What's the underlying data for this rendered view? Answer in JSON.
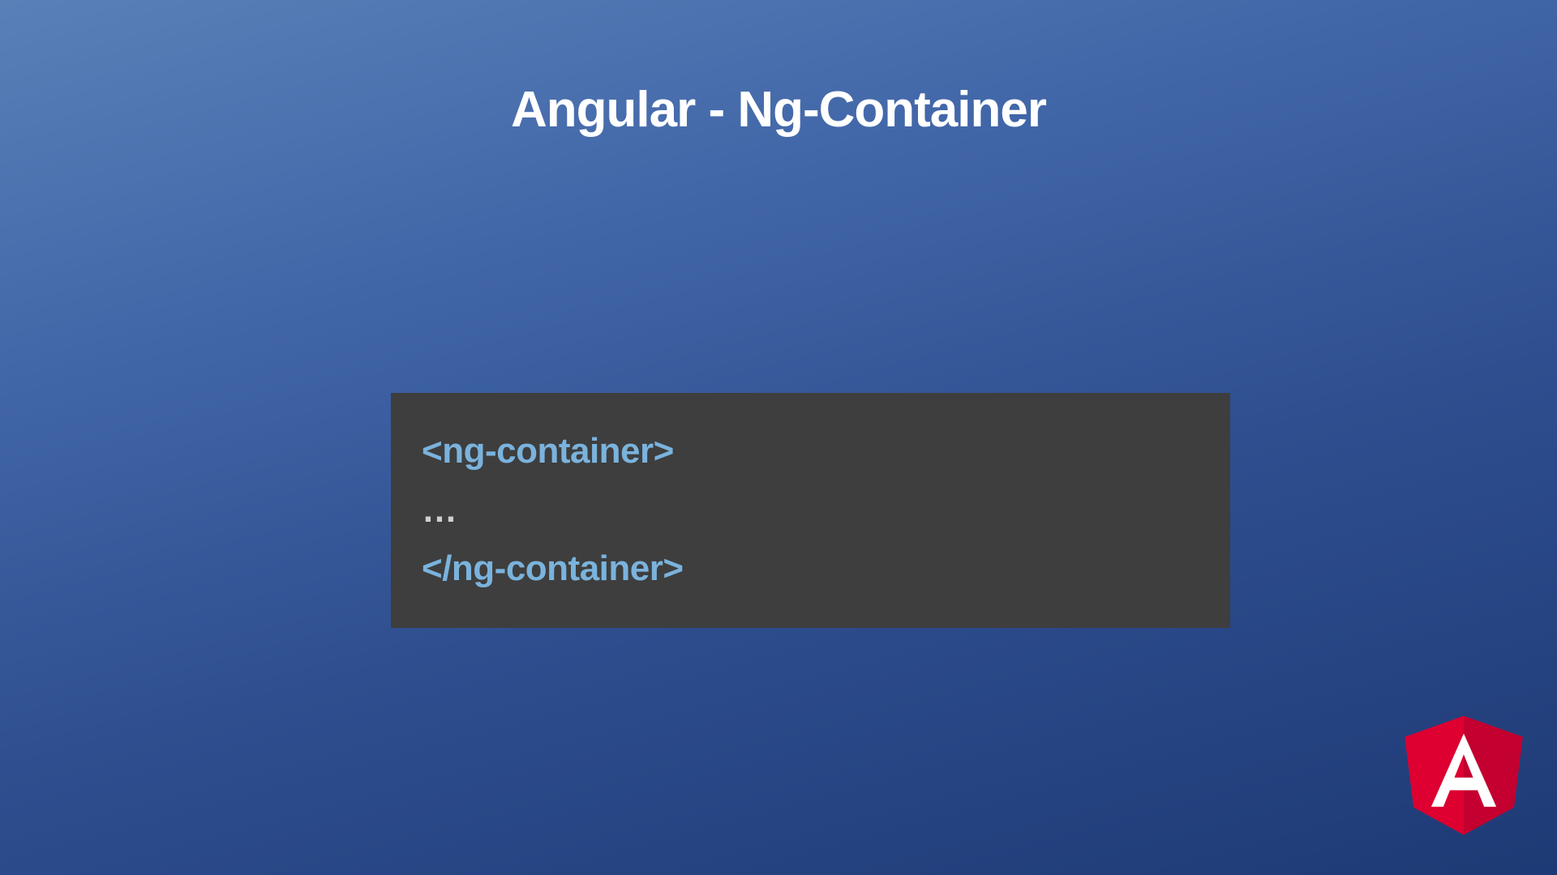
{
  "title": "Angular - Ng-Container",
  "code": {
    "line1": "<ng-container>",
    "line2": "…",
    "line3": "</ng-container>"
  }
}
